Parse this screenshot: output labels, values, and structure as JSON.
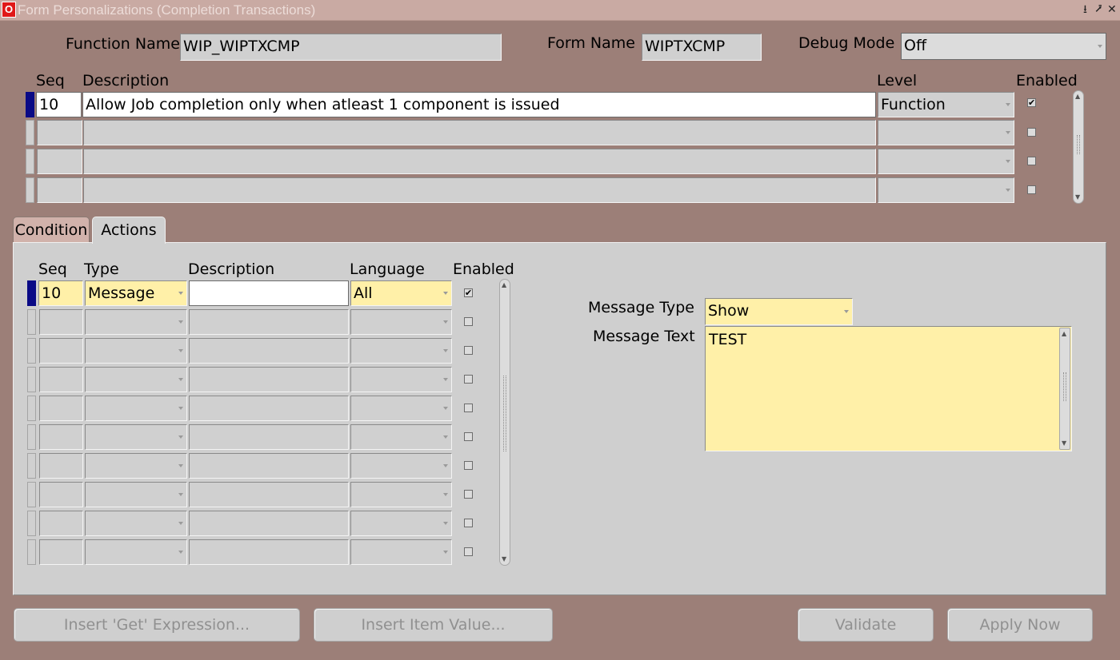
{
  "window": {
    "title": "Form Personalizations (Completion Transactions)",
    "logo_letter": "O",
    "controls": [
      "⭳",
      "⭷",
      "✕"
    ]
  },
  "header": {
    "function_name_label": "Function Name",
    "function_name_value": "WIP_WIPTXCMP",
    "form_name_label": "Form Name",
    "form_name_value": "WIPTXCMP",
    "debug_mode_label": "Debug Mode",
    "debug_mode_value": "Off"
  },
  "rules": {
    "columns": {
      "seq": "Seq",
      "description": "Description",
      "level": "Level",
      "enabled": "Enabled"
    },
    "rows": [
      {
        "seq": "10",
        "description": "Allow Job completion only when atleast 1 component is issued",
        "level": "Function",
        "enabled": true
      },
      {
        "seq": "",
        "description": "",
        "level": "",
        "enabled": false
      },
      {
        "seq": "",
        "description": "",
        "level": "",
        "enabled": false
      },
      {
        "seq": "",
        "description": "",
        "level": "",
        "enabled": false
      }
    ]
  },
  "tabs": {
    "condition": "Condition",
    "actions": "Actions"
  },
  "actions": {
    "columns": {
      "seq": "Seq",
      "type": "Type",
      "description": "Description",
      "language": "Language",
      "enabled": "Enabled"
    },
    "rows": [
      {
        "seq": "10",
        "type": "Message",
        "description": "",
        "language": "All",
        "enabled": true
      },
      {
        "seq": "",
        "type": "",
        "description": "",
        "language": "",
        "enabled": false
      },
      {
        "seq": "",
        "type": "",
        "description": "",
        "language": "",
        "enabled": false
      },
      {
        "seq": "",
        "type": "",
        "description": "",
        "language": "",
        "enabled": false
      },
      {
        "seq": "",
        "type": "",
        "description": "",
        "language": "",
        "enabled": false
      },
      {
        "seq": "",
        "type": "",
        "description": "",
        "language": "",
        "enabled": false
      },
      {
        "seq": "",
        "type": "",
        "description": "",
        "language": "",
        "enabled": false
      },
      {
        "seq": "",
        "type": "",
        "description": "",
        "language": "",
        "enabled": false
      },
      {
        "seq": "",
        "type": "",
        "description": "",
        "language": "",
        "enabled": false
      },
      {
        "seq": "",
        "type": "",
        "description": "",
        "language": "",
        "enabled": false
      }
    ],
    "message_type_label": "Message Type",
    "message_type_value": "Show",
    "message_text_label": "Message Text",
    "message_text_value": "TEST"
  },
  "buttons": {
    "insert_get": "Insert 'Get' Expression...",
    "insert_item": "Insert Item Value...",
    "validate": "Validate",
    "apply_now": "Apply Now"
  },
  "colors": {
    "background": "#9c7f78",
    "active_record": "#0a0a86",
    "required_field": "#fff0a8",
    "field": "#d0d0d0"
  },
  "icons": {
    "logo": "oracle-logo-icon",
    "checkbox_checked": "✔"
  }
}
